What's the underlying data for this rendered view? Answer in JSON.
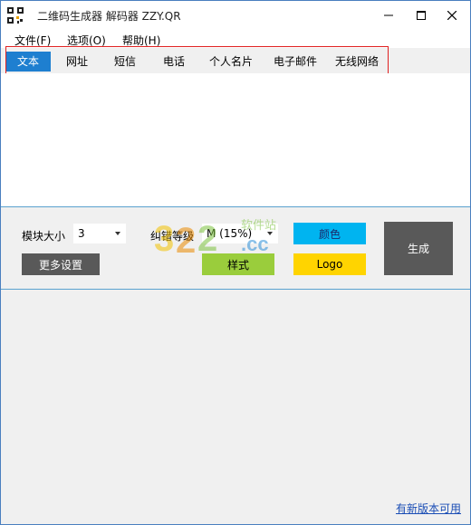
{
  "window": {
    "title": "二维码生成器 解码器 ZZY.QR"
  },
  "menu": {
    "items": [
      "文件(F)",
      "选项(O)",
      "帮助(H)"
    ]
  },
  "tabs": [
    {
      "label": "文本",
      "active": true
    },
    {
      "label": "网址",
      "active": false
    },
    {
      "label": "短信",
      "active": false
    },
    {
      "label": "电话",
      "active": false
    },
    {
      "label": "个人名片",
      "active": false
    },
    {
      "label": "电子邮件",
      "active": false
    },
    {
      "label": "无线网络",
      "active": false
    }
  ],
  "editor": {
    "value": ""
  },
  "controls": {
    "module_size_label": "模块大小",
    "module_size_value": "3",
    "error_level_label": "纠错等级",
    "error_level_value": "M (15%)",
    "more_settings": "更多设置",
    "style": "样式",
    "color": "颜色",
    "logo": "Logo",
    "generate": "生成"
  },
  "watermark": {
    "text": "软件站",
    "domain": ".cc"
  },
  "footer": {
    "update_link": "有新版本可用"
  },
  "colors": {
    "accent_blue": "#1e7fd0",
    "style_green": "#9acd3c",
    "color_cyan": "#00b4f0",
    "logo_yellow": "#ffd400",
    "generate_gray": "#595959",
    "more_gray": "#595959",
    "highlight_red": "#e02020"
  }
}
